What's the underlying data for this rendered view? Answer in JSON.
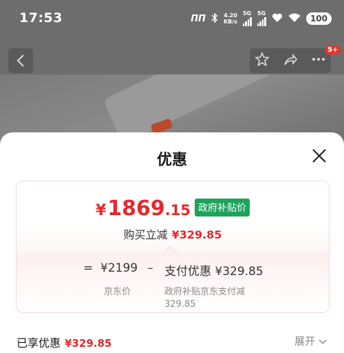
{
  "status_bar": {
    "time": "17:53",
    "net_speed_value": "4.20",
    "net_speed_unit": "KB/s",
    "sim1": "5G",
    "sim2": "5G",
    "battery": "100"
  },
  "product_nav": {
    "back_icon": "chevron-left-icon",
    "favorite_icon": "star-icon",
    "share_icon": "share-icon",
    "more_icon": "more-dots-icon",
    "message_badge": "5+"
  },
  "sheet": {
    "title": "优惠",
    "close_icon": "close-icon",
    "price": {
      "currency": "¥",
      "integer": "1869",
      "decimal": ".15",
      "tag": "政府补贴价"
    },
    "reduce": {
      "label": "购买立减",
      "amount": "¥329.85"
    },
    "breakdown": {
      "equals": "=",
      "jd_price": "¥2199",
      "minus": "–",
      "pay_discount": "支付优惠 ¥329.85",
      "jd_price_label": "京东价",
      "discount_label": "政府补贴京东支付减 329.85"
    }
  },
  "footer": {
    "enjoyed_label": "已享优惠",
    "enjoyed_amount": "¥329.85",
    "expand_label": "展开"
  },
  "colors": {
    "accent_red": "#e3292e",
    "tag_green": "#1fa35c"
  }
}
